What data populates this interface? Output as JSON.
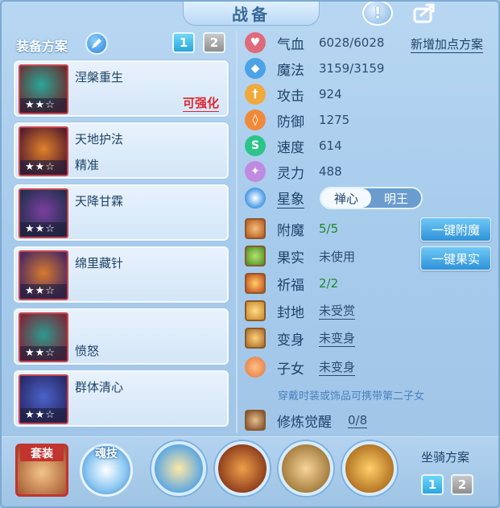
{
  "title": "战备",
  "help_icon_text": "!",
  "plans": {
    "label": "装备方案",
    "buttons": [
      "1",
      "2"
    ],
    "active": "1"
  },
  "equipment": [
    {
      "name": "涅槃重生",
      "sub": "",
      "tag": "可强化",
      "stars": "★★☆",
      "icon_colors": [
        "#2aa69a",
        "#6b2a2a"
      ]
    },
    {
      "name": "天地护法",
      "sub": "精准",
      "tag": "",
      "stars": "★★☆",
      "icon_colors": [
        "#e0822b",
        "#5a1f2b"
      ]
    },
    {
      "name": "天降甘霖",
      "sub": "",
      "tag": "",
      "stars": "★★☆",
      "icon_colors": [
        "#7b3fa0",
        "#24304f"
      ]
    },
    {
      "name": "绵里藏针",
      "sub": "",
      "tag": "",
      "stars": "★★☆",
      "icon_colors": [
        "#d87a2f",
        "#4a2a60"
      ]
    },
    {
      "name": "",
      "sub": "愤怒",
      "tag": "",
      "stars": "★★☆",
      "icon_colors": [
        "#2c9a8f",
        "#7a2a3a"
      ]
    },
    {
      "name": "群体清心",
      "sub": "",
      "tag": "",
      "stars": "★★☆",
      "icon_colors": [
        "#4b63c9",
        "#2a2a6a"
      ]
    }
  ],
  "stats": [
    {
      "label": "气血",
      "value": "6028/6028",
      "color": "#e06a7a",
      "glyph": "♥"
    },
    {
      "label": "魔法",
      "value": "3159/3159",
      "color": "#4ba3e6",
      "glyph": "◆"
    },
    {
      "label": "攻击",
      "value": "924",
      "color": "#f0a93a",
      "glyph": "†"
    },
    {
      "label": "防御",
      "value": "1275",
      "color": "#f08a3a",
      "glyph": "◊"
    },
    {
      "label": "速度",
      "value": "614",
      "color": "#2cc48a",
      "glyph": "S"
    },
    {
      "label": "灵力",
      "value": "488",
      "color": "#c08ae0",
      "glyph": "✦"
    }
  ],
  "add_point_link": "新增加点方案",
  "stance": {
    "label": "星象",
    "options": [
      "禅心",
      "明王"
    ],
    "active": "禅心"
  },
  "attributes": [
    {
      "label": "附魔",
      "value": "5/5",
      "style": "green"
    },
    {
      "label": "果实",
      "value": "未使用",
      "style": "plain"
    },
    {
      "label": "祈福",
      "value": "2/2",
      "style": "green"
    },
    {
      "label": "封地",
      "value": "未受赏",
      "style": "link"
    },
    {
      "label": "变身",
      "value": "未变身",
      "style": "link"
    },
    {
      "label": "子女",
      "value": "未变身",
      "style": "link"
    }
  ],
  "buttons": {
    "enchant_all": "一键附魔",
    "fruit_all": "一键果实"
  },
  "hint": "穿戴时装或饰品可携带第二子女",
  "cultivation": {
    "label": "修炼觉醒",
    "value": "0/8"
  },
  "bottom": {
    "set_label": "套装",
    "soul_label": "魂技",
    "mount_plan_label": "坐骑方案",
    "mount_plan_buttons": [
      "1",
      "2"
    ],
    "mount_plan_active": "1"
  }
}
